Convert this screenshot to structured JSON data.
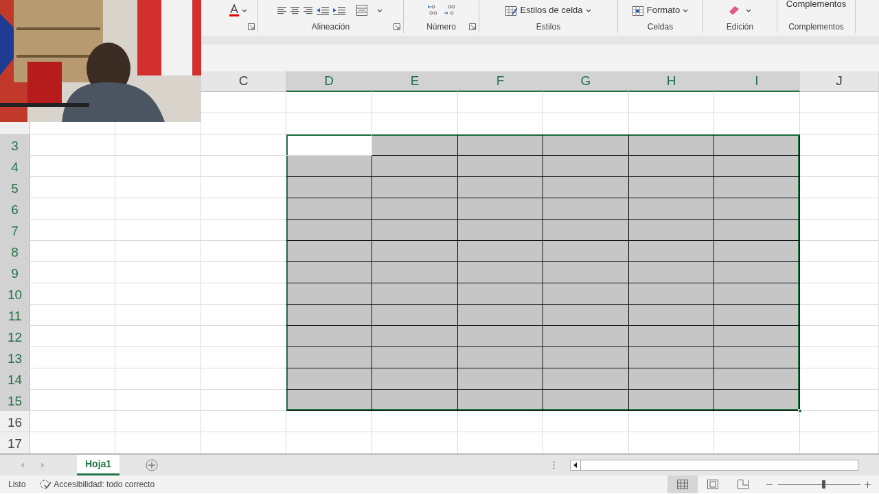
{
  "ribbon": {
    "groups": [
      {
        "kind": "font"
      },
      {
        "kind": "alignment",
        "label": "Alineación"
      },
      {
        "kind": "number",
        "label": "Número"
      },
      {
        "kind": "styles",
        "label": "Estilos",
        "buttons": [
          "Estilos de celda"
        ]
      },
      {
        "kind": "cells",
        "label": "Celdas",
        "buttons": [
          "Formato"
        ]
      },
      {
        "kind": "editing",
        "label": "Edición"
      },
      {
        "kind": "addins",
        "label": "Complementos",
        "buttons": [
          "Complementos"
        ]
      }
    ]
  },
  "columns": [
    {
      "label": "C",
      "selected": false
    },
    {
      "label": "D",
      "selected": true
    },
    {
      "label": "E",
      "selected": true
    },
    {
      "label": "F",
      "selected": true
    },
    {
      "label": "G",
      "selected": true
    },
    {
      "label": "H",
      "selected": true
    },
    {
      "label": "I",
      "selected": true
    },
    {
      "label": "J",
      "selected": false
    }
  ],
  "rows": [
    {
      "label": "3",
      "selected": true
    },
    {
      "label": "4",
      "selected": true
    },
    {
      "label": "5",
      "selected": true
    },
    {
      "label": "6",
      "selected": true
    },
    {
      "label": "7",
      "selected": true
    },
    {
      "label": "8",
      "selected": true
    },
    {
      "label": "9",
      "selected": true
    },
    {
      "label": "10",
      "selected": true
    },
    {
      "label": "11",
      "selected": true
    },
    {
      "label": "12",
      "selected": true
    },
    {
      "label": "13",
      "selected": true
    },
    {
      "label": "14",
      "selected": true
    },
    {
      "label": "15",
      "selected": true
    },
    {
      "label": "16",
      "selected": false
    },
    {
      "label": "17",
      "selected": false
    }
  ],
  "sheet_tabs": [
    {
      "label": "Hoja1",
      "selected": true
    }
  ],
  "status_bar": {
    "status": "Listo",
    "accessibility": "Accesibilidad: todo correcto",
    "views": [
      {
        "kind": "normal",
        "selected": true
      },
      {
        "kind": "page-layout",
        "selected": false
      },
      {
        "kind": "page-break",
        "selected": false
      }
    ],
    "zoom": {
      "level": 0.55
    }
  }
}
